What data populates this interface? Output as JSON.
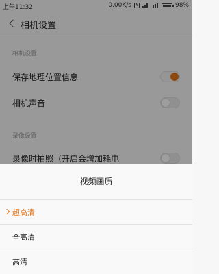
{
  "status_bar": {
    "time": "上午11:32",
    "network_speed": "0.00K/s",
    "nfc_letter": "N",
    "battery": "98%"
  },
  "header": {
    "title": "相机设置"
  },
  "sections": [
    {
      "title": "相机设置",
      "rows": [
        {
          "label": "保存地理位置信息",
          "toggle": "on"
        },
        {
          "label": "相机声音",
          "toggle": "off"
        }
      ]
    },
    {
      "title": "录像设置",
      "rows": [
        {
          "label": "录像时拍照（开启会增加耗电",
          "toggle": "off"
        }
      ]
    }
  ],
  "dialog": {
    "title": "视频画质",
    "options": [
      {
        "label": "超高清",
        "selected": true
      },
      {
        "label": "全高清",
        "selected": false
      },
      {
        "label": "高清",
        "selected": false
      }
    ]
  },
  "colors": {
    "accent": "#e6771c",
    "overlay": "rgba(0,0,0,0.38)"
  }
}
